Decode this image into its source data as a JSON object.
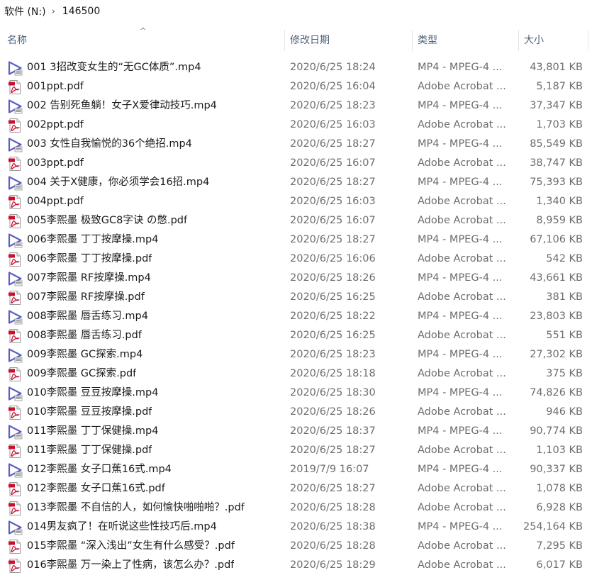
{
  "breadcrumb": {
    "drive": "软件 (N:)",
    "separator": "›",
    "folder": "146500"
  },
  "columns": {
    "sort_indicator": "^",
    "name": "名称",
    "date": "修改日期",
    "type": "类型",
    "size": "大小"
  },
  "files": [
    {
      "name": "001 3招改变女生的“无GC体质”.mp4",
      "date": "2020/6/25 18:24",
      "type": "MP4 - MPEG-4 ...",
      "size": "43,801 KB",
      "icon": "video-file-icon"
    },
    {
      "name": "001ppt.pdf",
      "date": "2020/6/25 16:04",
      "type": "Adobe Acrobat ...",
      "size": "5,187 KB",
      "icon": "pdf-file-icon"
    },
    {
      "name": "002 告别死鱼躺！女子X爱律动技巧.mp4",
      "date": "2020/6/25 18:23",
      "type": "MP4 - MPEG-4 ...",
      "size": "37,347 KB",
      "icon": "video-file-icon"
    },
    {
      "name": "002ppt.pdf",
      "date": "2020/6/25 16:03",
      "type": "Adobe Acrobat ...",
      "size": "1,703 KB",
      "icon": "pdf-file-icon"
    },
    {
      "name": "003 女性自我愉悦的36个绝招.mp4",
      "date": "2020/6/25 18:27",
      "type": "MP4 - MPEG-4 ...",
      "size": "85,549 KB",
      "icon": "video-file-icon"
    },
    {
      "name": "003ppt.pdf",
      "date": "2020/6/25 16:07",
      "type": "Adobe Acrobat ...",
      "size": "38,747 KB",
      "icon": "pdf-file-icon"
    },
    {
      "name": "004 关于X健康，你必须学会16招.mp4",
      "date": "2020/6/25 18:27",
      "type": "MP4 - MPEG-4 ...",
      "size": "75,393 KB",
      "icon": "video-file-icon"
    },
    {
      "name": "004ppt.pdf",
      "date": "2020/6/25 16:03",
      "type": "Adobe Acrobat ...",
      "size": "1,340 KB",
      "icon": "pdf-file-icon"
    },
    {
      "name": "005李熙墨 极致GC8字诀 の憋.pdf",
      "date": "2020/6/25 16:07",
      "type": "Adobe Acrobat ...",
      "size": "8,959 KB",
      "icon": "pdf-file-icon"
    },
    {
      "name": "006李熙墨 丁丁按摩操.mp4",
      "date": "2020/6/25 18:27",
      "type": "MP4 - MPEG-4 ...",
      "size": "67,106 KB",
      "icon": "video-file-icon"
    },
    {
      "name": "006李熙墨 丁丁按摩操.pdf",
      "date": "2020/6/25 16:06",
      "type": "Adobe Acrobat ...",
      "size": "542 KB",
      "icon": "pdf-file-icon"
    },
    {
      "name": "007李熙墨 RF按摩操.mp4",
      "date": "2020/6/25 18:26",
      "type": "MP4 - MPEG-4 ...",
      "size": "43,661 KB",
      "icon": "video-file-icon"
    },
    {
      "name": "007李熙墨 RF按摩操.pdf",
      "date": "2020/6/25 16:25",
      "type": "Adobe Acrobat ...",
      "size": "381 KB",
      "icon": "pdf-file-icon"
    },
    {
      "name": "008李熙墨 唇舌练习.mp4",
      "date": "2020/6/25 18:22",
      "type": "MP4 - MPEG-4 ...",
      "size": "23,803 KB",
      "icon": "video-file-icon"
    },
    {
      "name": "008李熙墨 唇舌练习.pdf",
      "date": "2020/6/25 16:25",
      "type": "Adobe Acrobat ...",
      "size": "551 KB",
      "icon": "pdf-file-icon"
    },
    {
      "name": "009李熙墨 GC探索.mp4",
      "date": "2020/6/25 18:23",
      "type": "MP4 - MPEG-4 ...",
      "size": "27,302 KB",
      "icon": "video-file-icon"
    },
    {
      "name": "009李熙墨 GC探索.pdf",
      "date": "2020/6/25 18:18",
      "type": "Adobe Acrobat ...",
      "size": "375 KB",
      "icon": "pdf-file-icon"
    },
    {
      "name": "010李熙墨 豆豆按摩操.mp4",
      "date": "2020/6/25 18:30",
      "type": "MP4 - MPEG-4 ...",
      "size": "74,826 KB",
      "icon": "video-file-icon"
    },
    {
      "name": "010李熙墨 豆豆按摩操.pdf",
      "date": "2020/6/25 18:26",
      "type": "Adobe Acrobat ...",
      "size": "946 KB",
      "icon": "pdf-file-icon"
    },
    {
      "name": "011李熙墨 丁丁保健操.mp4",
      "date": "2020/6/25 18:37",
      "type": "MP4 - MPEG-4 ...",
      "size": "90,774 KB",
      "icon": "video-file-icon"
    },
    {
      "name": "011李熙墨 丁丁保健操.pdf",
      "date": "2020/6/25 18:27",
      "type": "Adobe Acrobat ...",
      "size": "1,103 KB",
      "icon": "pdf-file-icon"
    },
    {
      "name": "012李熙墨 女子口蕉16式.mp4",
      "date": "2019/7/9 16:07",
      "type": "MP4 - MPEG-4 ...",
      "size": "90,337 KB",
      "icon": "video-file-icon"
    },
    {
      "name": "012李熙墨 女子口蕉16式.pdf",
      "date": "2020/6/25 18:27",
      "type": "Adobe Acrobat ...",
      "size": "1,078 KB",
      "icon": "pdf-file-icon"
    },
    {
      "name": "013李熙墨 不自信的人，如何愉快啪啪啪？.pdf",
      "date": "2020/6/25 18:28",
      "type": "Adobe Acrobat ...",
      "size": "6,928 KB",
      "icon": "pdf-file-icon"
    },
    {
      "name": "014男友疯了！在听说这些性技巧后.mp4",
      "date": "2020/6/25 18:38",
      "type": "MP4 - MPEG-4 ...",
      "size": "254,164 KB",
      "icon": "video-file-icon"
    },
    {
      "name": "015李熙墨 “深入浅出”女生有什么感受？.pdf",
      "date": "2020/6/25 18:28",
      "type": "Adobe Acrobat ...",
      "size": "7,295 KB",
      "icon": "pdf-file-icon"
    },
    {
      "name": "016李熙墨 万一染上了性病，该怎么办？.pdf",
      "date": "2020/6/25 18:29",
      "type": "Adobe Acrobat ...",
      "size": "6,017 KB",
      "icon": "pdf-file-icon"
    }
  ],
  "colors": {
    "header_text": "#4c607a",
    "secondary_text": "#6d6d6d",
    "video_icon": "#5b5fc7",
    "pdf_icon": "#c8102e"
  }
}
